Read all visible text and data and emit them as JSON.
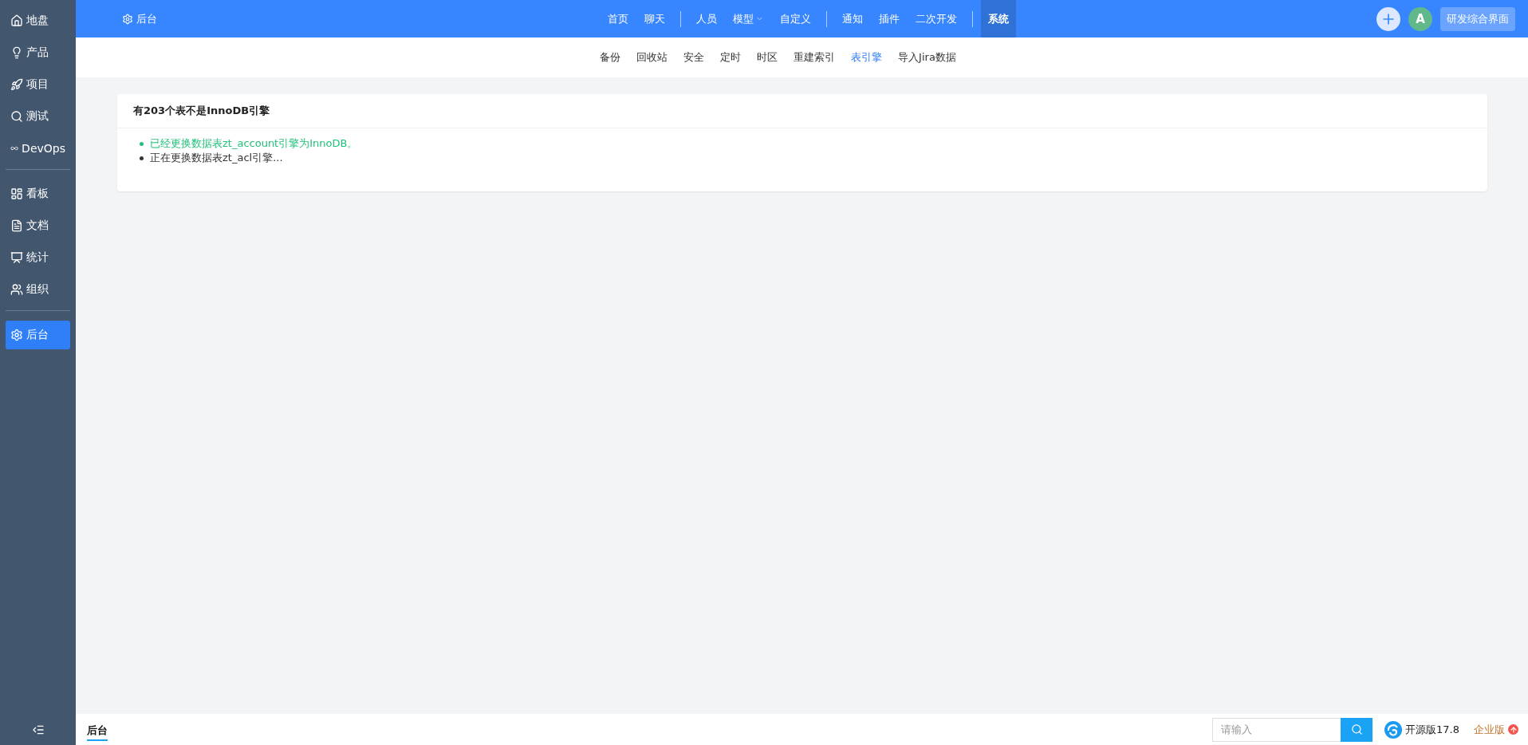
{
  "sidebar": {
    "groups": [
      {
        "items": [
          {
            "label": "地盘",
            "selected": false
          },
          {
            "label": "产品",
            "selected": false
          },
          {
            "label": "项目",
            "selected": false
          },
          {
            "label": "测试",
            "selected": false
          },
          {
            "label": "DevOps",
            "selected": false
          }
        ]
      },
      {
        "items": [
          {
            "label": "看板",
            "selected": false
          },
          {
            "label": "文档",
            "selected": false
          },
          {
            "label": "统计",
            "selected": false
          },
          {
            "label": "组织",
            "selected": false
          }
        ]
      },
      {
        "items": [
          {
            "label": "后台",
            "selected": true
          }
        ]
      }
    ]
  },
  "header": {
    "title": "后台",
    "nav_groups": [
      {
        "items": [
          {
            "label": "首页",
            "selected": false,
            "has_menu": false
          },
          {
            "label": "聊天",
            "selected": false,
            "has_menu": false
          }
        ]
      },
      {
        "items": [
          {
            "label": "人员",
            "selected": false,
            "has_menu": false
          },
          {
            "label": "模型",
            "selected": false,
            "has_menu": true
          },
          {
            "label": "自定义",
            "selected": false,
            "has_menu": false
          }
        ]
      },
      {
        "items": [
          {
            "label": "通知",
            "selected": false,
            "has_menu": false
          },
          {
            "label": "插件",
            "selected": false,
            "has_menu": false
          },
          {
            "label": "二次开发",
            "selected": false,
            "has_menu": false
          }
        ]
      },
      {
        "items": [
          {
            "label": "系统",
            "selected": true,
            "has_menu": false
          }
        ]
      }
    ],
    "avatar": "A",
    "switch_button": "研发综合界面"
  },
  "subnav": [
    {
      "label": "备份",
      "selected": false
    },
    {
      "label": "回收站",
      "selected": false
    },
    {
      "label": "安全",
      "selected": false
    },
    {
      "label": "定时",
      "selected": false
    },
    {
      "label": "时区",
      "selected": false
    },
    {
      "label": "重建索引",
      "selected": false
    },
    {
      "label": "表引擎",
      "selected": true
    },
    {
      "label": "导入Jira数据",
      "selected": false
    }
  ],
  "panel": {
    "title": "有203个表不是InnoDB引擎",
    "messages": [
      {
        "text": "已经更换数据表zt_account引擎为InnoDB。",
        "color": "#22c07a"
      },
      {
        "text": "正在更换数据表zt_acl引擎...",
        "color": "#333333"
      }
    ]
  },
  "footer": {
    "breadcrumb": "后台",
    "search": {
      "placeholder": "请输入"
    },
    "version": "开源版17.8",
    "upgrade": "企业版"
  }
}
